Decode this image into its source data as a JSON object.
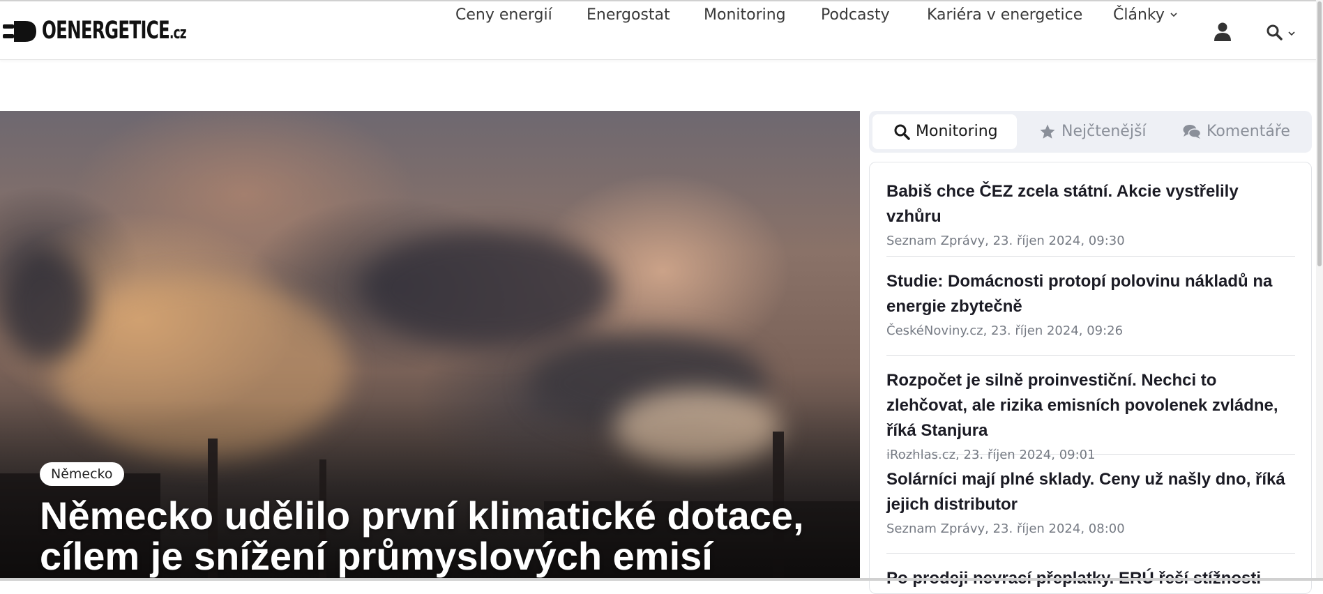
{
  "header": {
    "logo_text": "OENERGETICE",
    "logo_tld": ".cz",
    "nav": [
      {
        "label": "Ceny energií"
      },
      {
        "label": "Energostat"
      },
      {
        "label": "Monitoring"
      },
      {
        "label": "Podcasty"
      },
      {
        "label": "Kariéra v energetice"
      },
      {
        "label": "Články"
      }
    ],
    "icons": {
      "user": "user-icon",
      "search": "search-icon",
      "dropdown": "chevron-down-icon",
      "logo": "plug-icon"
    }
  },
  "hero": {
    "tag": "Německo",
    "title": "Německo udělilo první klimatické dotace, cílem je snížení průmyslových emisí"
  },
  "sidebar": {
    "tabs": [
      {
        "label": "Monitoring",
        "icon": "search-icon",
        "active": true
      },
      {
        "label": "Nejčtenější",
        "icon": "star-icon",
        "active": false
      },
      {
        "label": "Komentáře",
        "icon": "comments-icon",
        "active": false
      }
    ],
    "items": [
      {
        "title": "Babiš chce ČEZ zcela státní. Akcie vystřelily vzhůru",
        "meta": "Seznam Zprávy, 23. říjen 2024, 09:30"
      },
      {
        "title": "Studie: Domácnosti protopí polovinu nákladů na energie zbytečně",
        "meta": "ČeskéNoviny.cz, 23. říjen 2024, 09:26"
      },
      {
        "title": "Rozpočet je silně proinvestiční. Nechci to zlehčovat, ale rizika emisních povolenek zvládne, říká Stanjura",
        "meta": "iRozhlas.cz, 23. říjen 2024, 09:01"
      },
      {
        "title": "Solárníci mají plné sklady. Ceny už našly dno, říká jejich distributor",
        "meta": "Seznam Zprávy, 23. říjen 2024, 08:00"
      },
      {
        "title": "Po prodeji nevrací přeplatky. ERÚ řeší stížnosti",
        "meta": ""
      }
    ]
  },
  "colors": {
    "text": "#1b1b24",
    "muted": "#757a83",
    "tab_bg": "#eef0f5",
    "nav": "#3a3a3a"
  }
}
